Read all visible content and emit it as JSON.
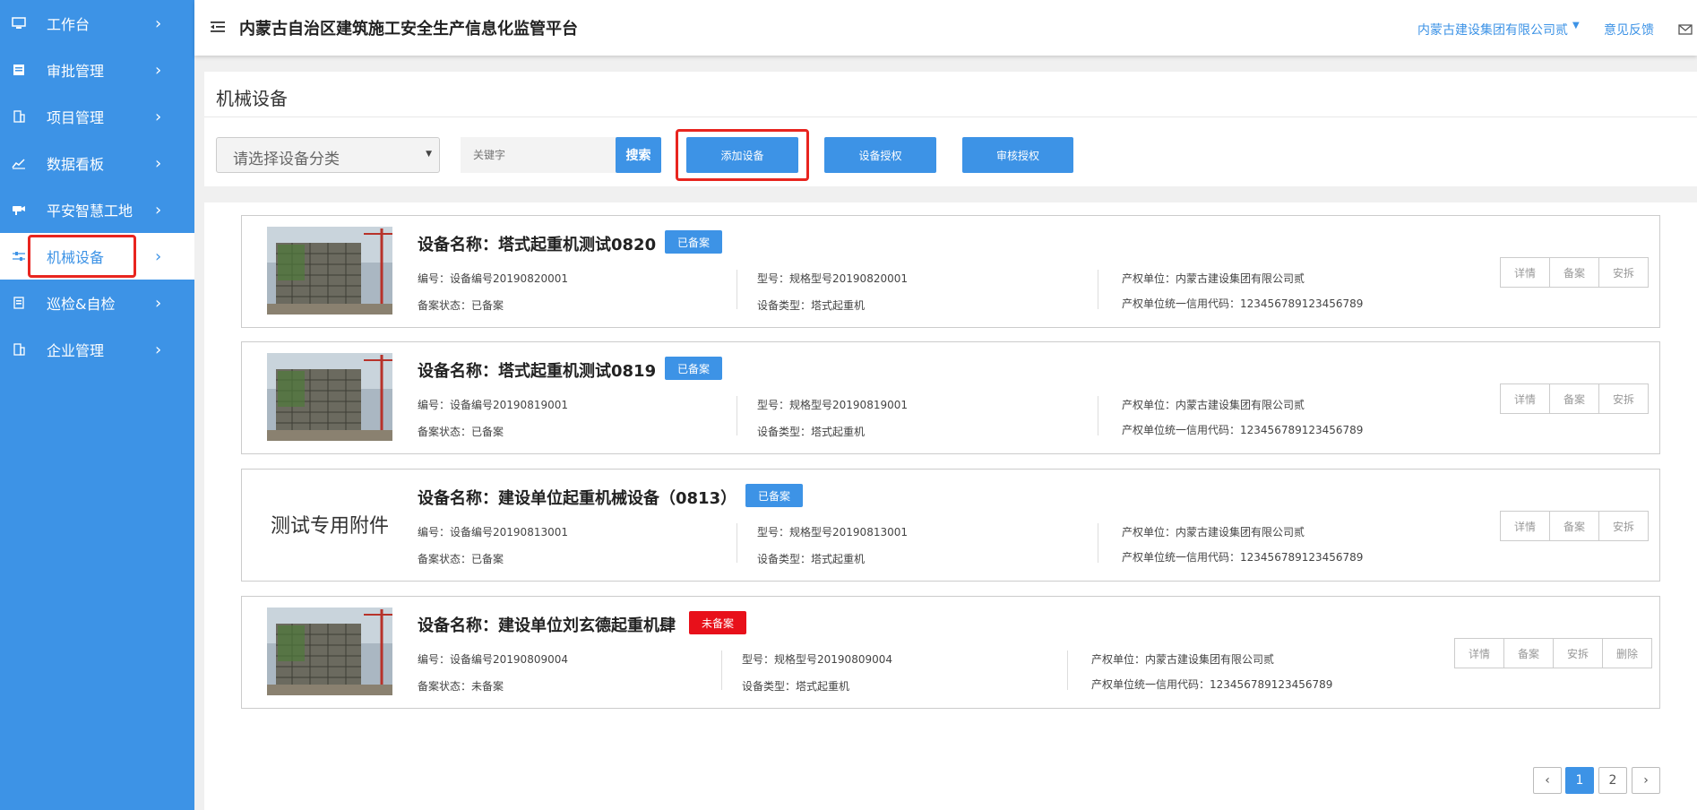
{
  "sidebar": {
    "items": [
      {
        "label": "工作台",
        "icon": "monitor-icon"
      },
      {
        "label": "审批管理",
        "icon": "document-icon"
      },
      {
        "label": "项目管理",
        "icon": "building-icon"
      },
      {
        "label": "数据看板",
        "icon": "chart-icon"
      },
      {
        "label": "平安智慧工地",
        "icon": "camera-icon"
      },
      {
        "label": "机械设备",
        "icon": "machine-icon"
      },
      {
        "label": "巡检&自检",
        "icon": "checklist-icon"
      },
      {
        "label": "企业管理",
        "icon": "company-icon"
      }
    ],
    "active_index": 5,
    "color": "#3d93e6"
  },
  "header": {
    "title": "内蒙古自治区建筑施工安全生产信息化监管平台",
    "company": "内蒙古建设集团有限公司贰",
    "feedback": "意见反馈"
  },
  "page": {
    "title": "机械设备",
    "select_placeholder": "请选择设备分类",
    "keyword_placeholder": "关键字",
    "search_label": "搜索",
    "add_label": "添加设备",
    "authorize_label": "设备授权",
    "review_label": "审核授权"
  },
  "labels": {
    "name_prefix": "设备名称：",
    "code_prefix": "编号：",
    "model_prefix": "型号：",
    "owner_prefix": "产权单位：",
    "status_prefix": "备案状态：",
    "type_prefix": "设备类型：",
    "credit_prefix": "产权单位统一信用代码："
  },
  "devices": [
    {
      "name": "塔式起重机测试0820",
      "badge": "已备案",
      "code": "设备编号20190820001",
      "model": "规格型号20190820001",
      "owner": "内蒙古建设集团有限公司贰",
      "status": "已备案",
      "type": "塔式起重机",
      "credit": "123456789123456789",
      "thumb_text": "",
      "actions": [
        "详情",
        "备案",
        "安拆"
      ]
    },
    {
      "name": "塔式起重机测试0819",
      "badge": "已备案",
      "code": "设备编号20190819001",
      "model": "规格型号20190819001",
      "owner": "内蒙古建设集团有限公司贰",
      "status": "已备案",
      "type": "塔式起重机",
      "credit": "123456789123456789",
      "thumb_text": "",
      "actions": [
        "详情",
        "备案",
        "安拆"
      ]
    },
    {
      "name": "建设单位起重机械设备（0813）",
      "badge": "已备案",
      "code": "设备编号20190813001",
      "model": "规格型号20190813001",
      "owner": "内蒙古建设集团有限公司贰",
      "status": "已备案",
      "type": "塔式起重机",
      "credit": "123456789123456789",
      "thumb_text": "测试专用附件",
      "actions": [
        "详情",
        "备案",
        "安拆"
      ]
    },
    {
      "name": "建设单位刘玄德起重机肆",
      "badge": "未备案",
      "code": "设备编号20190809004",
      "model": "规格型号20190809004",
      "owner": "内蒙古建设集团有限公司贰",
      "status": "未备案",
      "type": "塔式起重机",
      "credit": "123456789123456789",
      "thumb_text": "",
      "actions": [
        "详情",
        "备案",
        "安拆",
        "删除"
      ]
    }
  ],
  "pagination": {
    "prev": "‹",
    "pages": [
      "1",
      "2"
    ],
    "current": "1",
    "next": "›"
  }
}
